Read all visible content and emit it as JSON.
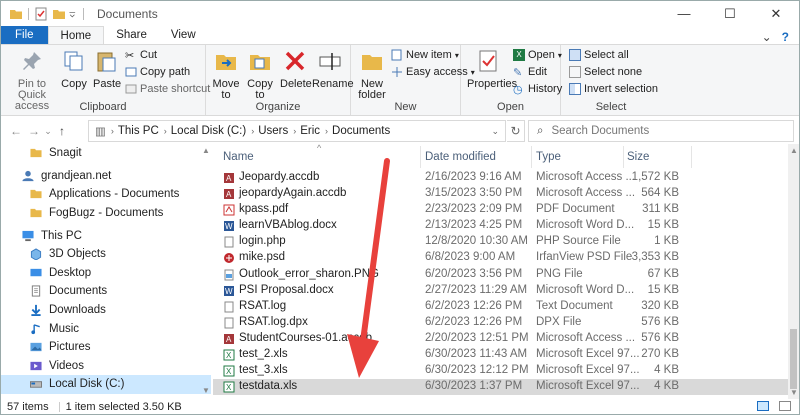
{
  "window": {
    "title": "Documents",
    "buttons": [
      "—",
      "☐",
      "✕"
    ]
  },
  "tabs": [
    "File",
    "Home",
    "Share",
    "View"
  ],
  "ribbon": {
    "clipboard": {
      "label": "Clipboard",
      "pin": "Pin to Quick access",
      "copy": "Copy",
      "paste": "Paste",
      "cut": "Cut",
      "copy_path": "Copy path",
      "paste_shortcut": "Paste shortcut"
    },
    "organize": {
      "label": "Organize",
      "move": "Move to",
      "copy": "Copy to",
      "delete": "Delete",
      "rename": "Rename"
    },
    "new": {
      "label": "New",
      "folder": "New folder",
      "item": "New item",
      "easy": "Easy access"
    },
    "open": {
      "label": "Open",
      "properties": "Properties",
      "open": "Open",
      "edit": "Edit",
      "history": "History"
    },
    "select": {
      "label": "Select",
      "all": "Select all",
      "none": "Select none",
      "invert": "Invert selection"
    }
  },
  "address": {
    "crumbs": [
      "This PC",
      "Local Disk (C:)",
      "Users",
      "Eric",
      "Documents"
    ],
    "search_placeholder": "Search Documents"
  },
  "nav": [
    {
      "label": "Snagit",
      "icon": "folder-icon",
      "indent": 28
    },
    {
      "label": "grandjean.net",
      "icon": "user-icon",
      "indent": 20
    },
    {
      "label": "Applications - Documents",
      "icon": "folder-icon",
      "indent": 28
    },
    {
      "label": "FogBugz - Documents",
      "icon": "folder-icon",
      "indent": 28
    },
    {
      "label": "This PC",
      "icon": "computer-icon",
      "indent": 20
    },
    {
      "label": "3D Objects",
      "icon": "cube-icon",
      "indent": 28
    },
    {
      "label": "Desktop",
      "icon": "desktop-icon",
      "indent": 28
    },
    {
      "label": "Documents",
      "icon": "documents-icon",
      "indent": 28
    },
    {
      "label": "Downloads",
      "icon": "download-icon",
      "indent": 28
    },
    {
      "label": "Music",
      "icon": "music-icon",
      "indent": 28
    },
    {
      "label": "Pictures",
      "icon": "pictures-icon",
      "indent": 28
    },
    {
      "label": "Videos",
      "icon": "videos-icon",
      "indent": 28
    },
    {
      "label": "Local Disk (C:)",
      "icon": "drive-icon",
      "indent": 28
    }
  ],
  "columns": {
    "name": "Name",
    "date": "Date modified",
    "type": "Type",
    "size": "Size"
  },
  "files": [
    {
      "name": "Jeopardy.accdb",
      "date": "2/16/2023 9:16 AM",
      "type": "Microsoft Access ...",
      "size": "1,572 KB",
      "icon": "access-icon"
    },
    {
      "name": "jeopardyAgain.accdb",
      "date": "3/15/2023 3:50 PM",
      "type": "Microsoft Access ...",
      "size": "564 KB",
      "icon": "access-icon"
    },
    {
      "name": "kpass.pdf",
      "date": "2/23/2023 2:09 PM",
      "type": "PDF Document",
      "size": "311 KB",
      "icon": "pdf-icon"
    },
    {
      "name": "learnVBAblog.docx",
      "date": "2/13/2023 4:25 PM",
      "type": "Microsoft Word D...",
      "size": "15 KB",
      "icon": "word-icon"
    },
    {
      "name": "login.php",
      "date": "12/8/2020 10:30 AM",
      "type": "PHP Source File",
      "size": "1 KB",
      "icon": "file-icon"
    },
    {
      "name": "mike.psd",
      "date": "6/8/2023 9:00 AM",
      "type": "IrfanView PSD File",
      "size": "3,353 KB",
      "icon": "irfanview-icon"
    },
    {
      "name": "Outlook_error_sharon.PNG",
      "date": "6/20/2023 3:56 PM",
      "type": "PNG File",
      "size": "67 KB",
      "icon": "image-icon"
    },
    {
      "name": "PSI Proposal.docx",
      "date": "2/27/2023 11:29 AM",
      "type": "Microsoft Word D...",
      "size": "15 KB",
      "icon": "word-icon"
    },
    {
      "name": "RSAT.log",
      "date": "6/2/2023 12:26 PM",
      "type": "Text Document",
      "size": "320 KB",
      "icon": "file-icon"
    },
    {
      "name": "RSAT.log.dpx",
      "date": "6/2/2023 12:26 PM",
      "type": "DPX File",
      "size": "576 KB",
      "icon": "file-icon"
    },
    {
      "name": "StudentCourses-01.accdb",
      "date": "2/20/2023 12:51 PM",
      "type": "Microsoft Access ...",
      "size": "576 KB",
      "icon": "access-icon"
    },
    {
      "name": "test_2.xls",
      "date": "6/30/2023 11:43 AM",
      "type": "Microsoft Excel 97...",
      "size": "270 KB",
      "icon": "excel-icon"
    },
    {
      "name": "test_3.xls",
      "date": "6/30/2023 12:12 PM",
      "type": "Microsoft Excel 97...",
      "size": "4 KB",
      "icon": "excel-icon"
    },
    {
      "name": "testdata.xls",
      "date": "6/30/2023 1:37 PM",
      "type": "Microsoft Excel 97...",
      "size": "4 KB",
      "icon": "excel-icon",
      "selected": true
    }
  ],
  "status": {
    "items": "57 items",
    "selected": "1 item selected  3.50 KB"
  },
  "colors": {
    "file_tab": "#1a6dc2",
    "selected_row": "#d9d9d9",
    "nav_selected": "#cce8ff",
    "arrow": "#e8413c"
  }
}
